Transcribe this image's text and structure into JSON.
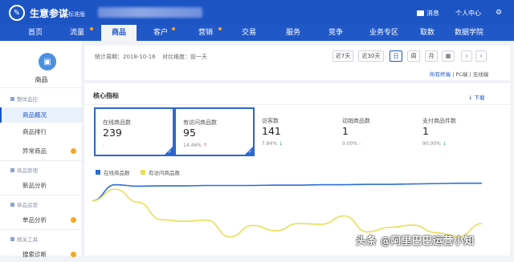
{
  "header": {
    "app_title": "生意参谋",
    "edition": "标准版",
    "message_label": "消息",
    "user_center_label": "个人中心"
  },
  "nav": {
    "items": [
      {
        "label": "首页",
        "active": false
      },
      {
        "label": "流量",
        "active": false
      },
      {
        "label": "商品",
        "active": true
      },
      {
        "label": "客户",
        "active": false
      },
      {
        "label": "营销",
        "active": false
      },
      {
        "label": "交易",
        "active": false
      },
      {
        "label": "服务",
        "active": false
      },
      {
        "label": "竞争",
        "active": false
      },
      {
        "label": "业务专区",
        "active": false
      },
      {
        "label": "取数",
        "active": false
      },
      {
        "label": "数据学院",
        "active": false
      }
    ]
  },
  "sidebar": {
    "title": "商品",
    "sections": [
      {
        "label": "整体监控",
        "items": [
          "商品概况",
          "商品排行",
          "异常商品"
        ]
      },
      {
        "label": "商品管理",
        "items": [
          "新品分析"
        ]
      },
      {
        "label": "单品运营",
        "items": [
          "单品分析"
        ]
      },
      {
        "label": "相关工具",
        "items": [
          "搜索诊断"
        ]
      }
    ],
    "active_item": "商品概况"
  },
  "filter": {
    "period_text": "统计周期：2018-10-16",
    "compare_text": "对比维度：前一天",
    "buttons": [
      "近7天",
      "近30天",
      "日",
      "周",
      "月"
    ],
    "selected": "日",
    "terminals": {
      "all": "所有终端",
      "pc": "PC端",
      "wireless": "无线端",
      "sep": "|"
    }
  },
  "panel": {
    "title": "核心指标",
    "download_label": "下载",
    "metrics": [
      {
        "label": "在线商品数",
        "value": "239",
        "sub": "-",
        "trend": "none",
        "selected": true
      },
      {
        "label": "有访问商品数",
        "value": "95",
        "sub": "14.46%",
        "trend": "up",
        "selected": true
      },
      {
        "label": "访客数",
        "value": "141",
        "sub": "7.84%",
        "trend": "down",
        "selected": false
      },
      {
        "label": "动销商品数",
        "value": "1",
        "sub": "0.00%",
        "trend": "none",
        "selected": false
      },
      {
        "label": "支付商品件数",
        "value": "1",
        "sub": "90.00%",
        "trend": "down",
        "selected": false
      }
    ]
  },
  "colors": {
    "brand_blue": "#1c54c4",
    "series_blue": "#2a6dd2",
    "series_yellow": "#e6df5a"
  },
  "chart_data": {
    "type": "line",
    "series": [
      {
        "name": "在线商品数",
        "values": [
          200,
          242,
          238,
          239,
          239,
          240,
          240,
          240,
          241,
          241,
          242,
          242,
          243,
          243,
          244,
          245,
          246,
          246
        ]
      },
      {
        "name": "有访问商品数",
        "values": [
          200,
          230,
          196,
          150,
          146,
          149,
          105,
          135,
          121,
          140,
          138,
          160,
          118,
          130,
          136,
          116,
          106,
          140
        ]
      }
    ],
    "ylim": [
      60,
      260
    ],
    "legend": "top-left"
  },
  "watermark": "头条 @阿里巴巴运营小知"
}
